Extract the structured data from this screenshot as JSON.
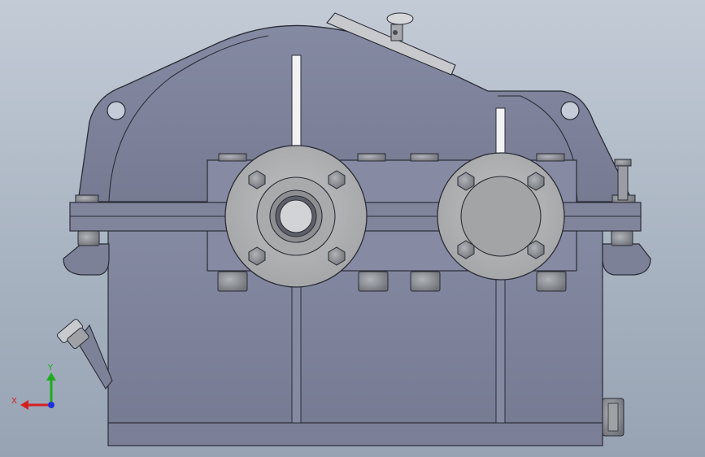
{
  "viewport": {
    "background_top": "#c3cbd6",
    "background_bottom": "#97a3b3"
  },
  "model": {
    "housing_color": "#7e849c",
    "housing_shadow": "#6c7189",
    "edge_color": "#2a2c35",
    "flange_color": "#b2b3b4",
    "bolt_color": "#8d9095",
    "shaft_label": ""
  },
  "triad": {
    "x_label": "X",
    "y_label": "Y",
    "x_color": "#d42020",
    "y_color": "#1faa1f",
    "z_color": "#2030d8"
  }
}
